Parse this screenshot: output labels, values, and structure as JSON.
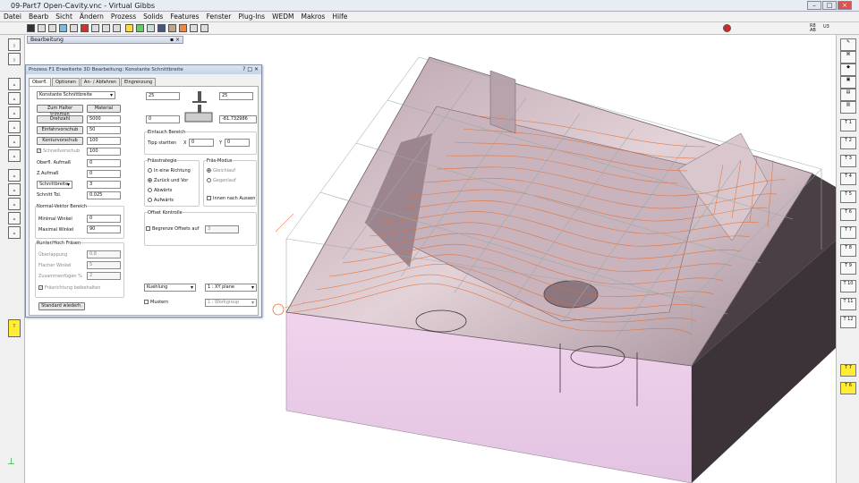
{
  "app": {
    "title": "09-Part7 Open-Cavity.vnc - Virtual Gibbs"
  },
  "menu": [
    "Datei",
    "Bearb",
    "Sicht",
    "Ändern",
    "Prozess",
    "Solids",
    "Features",
    "Fenster",
    "Plug-Ins",
    "WEDM",
    "Makros",
    "Hilfe"
  ],
  "small_window": {
    "title": "Bearbeitung"
  },
  "panel": {
    "title": "Prozess F1 Erweiterte 3D Bearbeitung: Konstante Schnittbreite",
    "tabs": [
      "Oberfl.",
      "Optionen",
      "An- / Abfahren",
      "Eingrenzung"
    ],
    "method": "Konstante Schnittbreite",
    "btn_holder": "Zum Halter trimmen",
    "btn_material": "Material",
    "btn_speed": "Drehzahl",
    "speed": "5000",
    "btn_plunge": "Einfahrvorschub",
    "plunge": "50",
    "btn_contour": "Konturvorschub",
    "contour": "100",
    "rapid_label": "Schnellvorschub",
    "rapid": "100",
    "top_stock_label": "Oberfl. Aufmaß",
    "top_stock": "0",
    "z_stock_label": "Z Aufmaß",
    "z_stock": "0",
    "cut_width_label": "Schnittbreite",
    "cut_width": "3",
    "cut_tol_label": "Schnitt Tol.",
    "cut_tol": "0.025",
    "normal_range_title": "Normal-Vektor Bereich",
    "min_angle_label": "Minimal Winkel",
    "min_angle": "0",
    "max_angle_label": "Maximal Winkel",
    "max_angle": "90",
    "rough_title": "Runter/Hoch Fräsen",
    "overlap_label": "Überlappung",
    "overlap": "0.8",
    "flat_angle_label": "Flacher Winkel",
    "flat_angle": "5",
    "merge_label": "Zusammenfügen %",
    "merge": "2",
    "keep_dir_label": "Fräsrichtung beibehalten",
    "btn_restore": "Standard wiederh.",
    "tool_top_left": "25",
    "tool_top_right": "25",
    "tool_bot_left": "0",
    "tool_bot_right": "-81.732986",
    "plunge_area_title": "Eintauch Bereich",
    "tip_start_label": "Tipp startten",
    "x_label": "X",
    "x_val": "0",
    "y_label": "Y",
    "y_val": "0",
    "strategy_title": "Frässtrategie",
    "strategies": [
      "In eine Richtung",
      "Zurück und Vor",
      "Abwärts",
      "Aufwärts"
    ],
    "mode_title": "Fräs-Modus",
    "modes": [
      "Gleichlauf",
      "Gegenlauf"
    ],
    "inside_out_label": "Innen nach Aussen",
    "offset_title": "Offset Kontrolle",
    "limit_offsets_label": "Begrenze Offsets auf",
    "limit_offsets": "3",
    "coolant": "Kuehlung",
    "plane": "1 : XY plane",
    "pattern_label": "Mustern",
    "workgroup": "1 : Workgroup"
  },
  "right_tools": [
    "T 1",
    "T 2",
    "T 3",
    "T 4",
    "T 5",
    "T 6",
    "T 7",
    "T 8",
    "T 9",
    "T 10",
    "T 11",
    "T 12",
    "T 7",
    "T 6"
  ],
  "colors": {
    "toolpath": "#e56a2a",
    "part_top": "#d8c3cb",
    "part_side": "#e6c6e4",
    "part_dark": "#3b3337",
    "highlight": "#ffee33"
  }
}
